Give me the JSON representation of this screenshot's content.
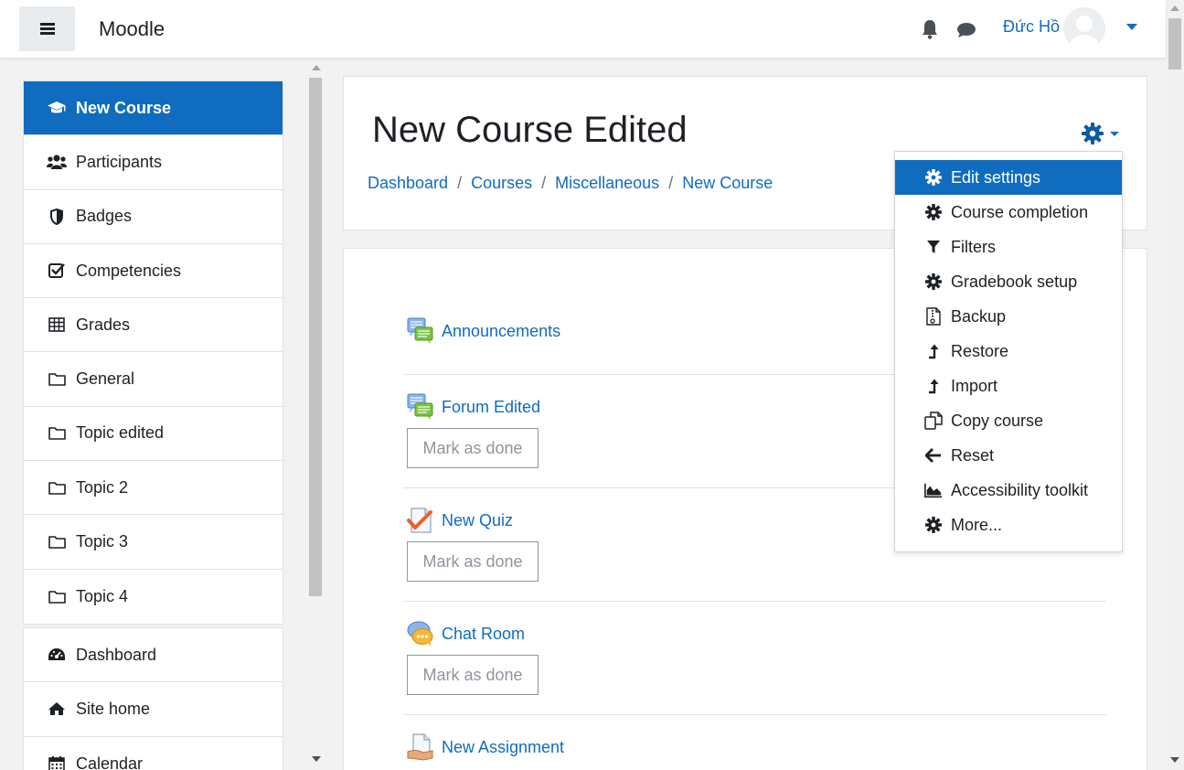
{
  "navbar": {
    "brand": "Moodle",
    "user_name": "Đức Hồ"
  },
  "drawer": {
    "course_items": [
      {
        "label": "New Course",
        "icon": "graduation-cap-icon",
        "active": true
      },
      {
        "label": "Participants",
        "icon": "users-icon"
      },
      {
        "label": "Badges",
        "icon": "shield-icon"
      },
      {
        "label": "Competencies",
        "icon": "checkbox-icon"
      },
      {
        "label": "Grades",
        "icon": "table-icon"
      },
      {
        "label": "General",
        "icon": "folder-icon"
      },
      {
        "label": "Topic edited",
        "icon": "folder-icon"
      },
      {
        "label": "Topic 2",
        "icon": "folder-icon"
      },
      {
        "label": "Topic 3",
        "icon": "folder-icon"
      },
      {
        "label": "Topic 4",
        "icon": "folder-icon"
      }
    ],
    "site_items": [
      {
        "label": "Dashboard",
        "icon": "dashboard-icon"
      },
      {
        "label": "Site home",
        "icon": "home-icon"
      },
      {
        "label": "Calendar",
        "icon": "calendar-icon"
      }
    ]
  },
  "header": {
    "title": "New Course Edited",
    "breadcrumb": [
      "Dashboard",
      "Courses",
      "Miscellaneous",
      "New Course"
    ],
    "breadcrumb_separator": "/"
  },
  "activities": [
    {
      "name": "Announcements",
      "icon": "forum-icon",
      "mark_button": null
    },
    {
      "name": "Forum Edited",
      "icon": "forum-icon",
      "mark_button": "Mark as done"
    },
    {
      "name": "New Quiz",
      "icon": "quiz-icon",
      "mark_button": "Mark as done"
    },
    {
      "name": "Chat Room",
      "icon": "chat-icon",
      "mark_button": "Mark as done"
    },
    {
      "name": "New Assignment",
      "icon": "assignment-icon",
      "mark_button": null
    }
  ],
  "admin_menu": {
    "items": [
      {
        "label": "Edit settings",
        "icon": "cog-icon",
        "active": true
      },
      {
        "label": "Course completion",
        "icon": "cog-icon"
      },
      {
        "label": "Filters",
        "icon": "filter-icon"
      },
      {
        "label": "Gradebook setup",
        "icon": "cog-icon"
      },
      {
        "label": "Backup",
        "icon": "file-archive-icon"
      },
      {
        "label": "Restore",
        "icon": "level-up-icon"
      },
      {
        "label": "Import",
        "icon": "level-up-icon"
      },
      {
        "label": "Copy course",
        "icon": "copy-icon"
      },
      {
        "label": "Reset",
        "icon": "arrow-left-icon"
      },
      {
        "label": "Accessibility toolkit",
        "icon": "area-chart-icon"
      },
      {
        "label": "More...",
        "icon": "cog-icon"
      }
    ]
  },
  "colors": {
    "primary": "#0f6cbf",
    "text": "#1d2125",
    "border": "#dee2e6",
    "background": "#f2f2f2"
  }
}
